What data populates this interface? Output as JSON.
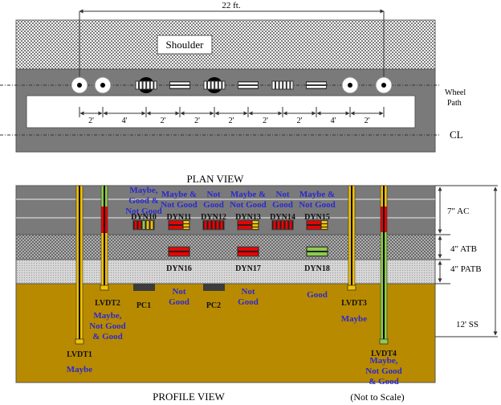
{
  "plan_view": {
    "title": "PLAN VIEW",
    "width_label": "22 ft.",
    "shoulder_label": "Shoulder",
    "wheel_path_label_1": "Wheel",
    "wheel_path_label_2": "Path",
    "centerline_label": "CL",
    "spacings": [
      "2'",
      "4'",
      "2'",
      "2'",
      "2'",
      "2'",
      "2'",
      "4'",
      "2'"
    ],
    "sensors": [
      {
        "type": "lvdt",
        "icon": "lvdt-icon"
      },
      {
        "type": "lvdt",
        "icon": "lvdt-icon"
      },
      {
        "type": "pressure-cell",
        "icon": "pressure-cell-icon"
      },
      {
        "type": "dynatest-horizontal",
        "icon": "strain-gauge-horizontal-icon"
      },
      {
        "type": "pressure-cell",
        "icon": "pressure-cell-icon"
      },
      {
        "type": "dynatest-horizontal",
        "icon": "strain-gauge-horizontal-icon"
      },
      {
        "type": "dynatest-vertical",
        "icon": "strain-gauge-vertical-icon"
      },
      {
        "type": "dynatest-horizontal",
        "icon": "strain-gauge-horizontal-icon"
      },
      {
        "type": "lvdt",
        "icon": "lvdt-icon"
      },
      {
        "type": "lvdt",
        "icon": "lvdt-icon"
      }
    ]
  },
  "profile_view": {
    "title": "PROFILE VIEW",
    "scale_note": "(Not to Scale)",
    "layers": [
      {
        "name": "7\" AC",
        "color": "#7a7a7a"
      },
      {
        "name": "4\" ATB",
        "color": "#9a9a9a"
      },
      {
        "name": "4\" PATB",
        "color": "#cfcfcf"
      },
      {
        "name": "12' SS",
        "color": "#b88a00"
      }
    ],
    "dyn_gauges": [
      {
        "id": "DYN10",
        "rating": [
          "Maybe,",
          "Good &",
          "Not Good"
        ],
        "colors": [
          "red",
          "red",
          "green",
          "yellow",
          "yellow"
        ]
      },
      {
        "id": "DYN11",
        "rating": [
          "Maybe &",
          "Not Good"
        ],
        "colors": [
          "red",
          "yellow"
        ]
      },
      {
        "id": "DYN12",
        "rating": [
          "Not",
          "Good"
        ],
        "colors": [
          "red"
        ]
      },
      {
        "id": "DYN13",
        "rating": [
          "Maybe &",
          "Not Good"
        ],
        "colors": [
          "red",
          "yellow"
        ]
      },
      {
        "id": "DYN14",
        "rating": [
          "Not",
          "Good"
        ],
        "colors": [
          "red"
        ]
      },
      {
        "id": "DYN15",
        "rating": [
          "Maybe &",
          "Not Good"
        ],
        "colors": [
          "red",
          "yellow"
        ]
      },
      {
        "id": "DYN16",
        "rating": [
          "Not",
          "Good"
        ],
        "colors": [
          "red"
        ]
      },
      {
        "id": "DYN17",
        "rating": [
          "Not",
          "Good"
        ],
        "colors": [
          "red"
        ]
      },
      {
        "id": "DYN18",
        "rating": [
          "Good"
        ],
        "colors": [
          "green"
        ]
      }
    ],
    "pressure_cells": [
      {
        "id": "PC1"
      },
      {
        "id": "PC2"
      }
    ],
    "lvdts": [
      {
        "id": "LVDT1",
        "rating": [
          "Maybe"
        ]
      },
      {
        "id": "LVDT2",
        "rating": [
          "Maybe,",
          "Not Good",
          "& Good"
        ]
      },
      {
        "id": "LVDT3",
        "rating": [
          "Maybe"
        ]
      },
      {
        "id": "LVDT4",
        "rating": [
          "Maybe,",
          "Not Good",
          "& Good"
        ]
      }
    ]
  },
  "colors": {
    "good": "#8ccc4c",
    "maybe": "#f2c000",
    "not_good": "#ee0000",
    "rating_text": "#2a2acf"
  }
}
